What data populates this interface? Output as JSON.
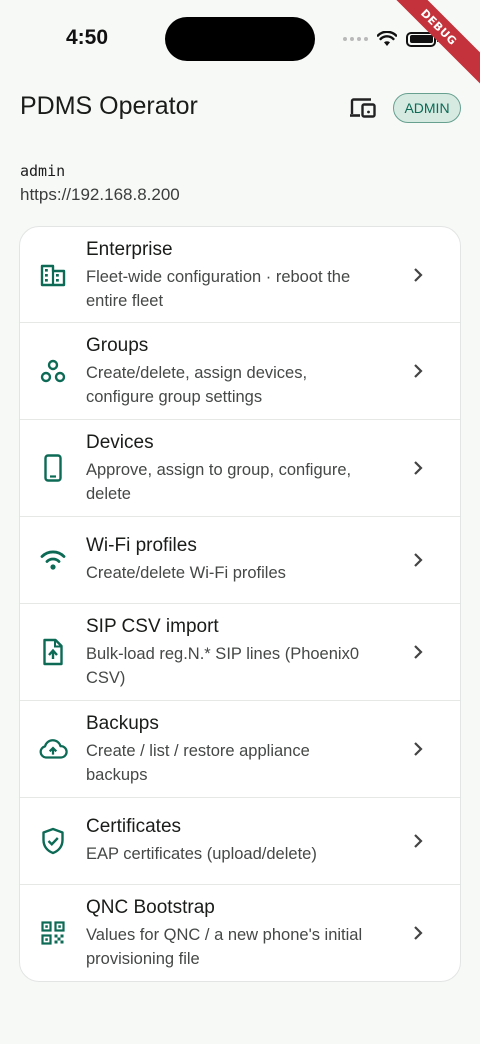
{
  "status_bar": {
    "time": "4:50",
    "icons": [
      "cellular-dots-icon",
      "wifi-icon",
      "battery-icon"
    ]
  },
  "debug_banner": "DEBUG",
  "app_bar": {
    "title": "PDMS Operator",
    "devices_icon": "devices-icon",
    "role_chip": "ADMIN"
  },
  "session": {
    "username": "admin",
    "server": "https://192.168.8.200"
  },
  "colors": {
    "accent": "#0c6a55",
    "chip_bg": "#d6eae2",
    "debug_banner": "#c4323b",
    "background": "#f7f9f7"
  },
  "menu": {
    "items": [
      {
        "icon": "enterprise-building-icon",
        "title": "Enterprise",
        "subtitle_lines": [
          "Fleet-wide configuration · reboot the",
          "entire fleet"
        ]
      },
      {
        "icon": "groups-icon",
        "title": "Groups",
        "subtitle_lines": [
          "Create/delete, assign devices,",
          "configure group settings"
        ]
      },
      {
        "icon": "smartphone-icon",
        "title": "Devices",
        "subtitle_lines": [
          "Approve, assign to group, configure,",
          "delete"
        ]
      },
      {
        "icon": "wifi-icon",
        "title": "Wi-Fi profiles",
        "subtitle_lines": [
          "Create/delete Wi-Fi profiles"
        ]
      },
      {
        "icon": "file-upload-icon",
        "title": "SIP CSV import",
        "subtitle_lines": [
          "Bulk-load reg.N.* SIP lines (Phoenix0",
          "CSV)"
        ]
      },
      {
        "icon": "cloud-upload-icon",
        "title": "Backups",
        "subtitle_lines": [
          "Create / list / restore appliance",
          "backups"
        ]
      },
      {
        "icon": "shield-check-icon",
        "title": "Certificates",
        "subtitle_lines": [
          "EAP certificates (upload/delete)"
        ]
      },
      {
        "icon": "qr-code-icon",
        "title": "QNC Bootstrap",
        "subtitle_lines": [
          "Values for QNC / a new phone's initial",
          "provisioning file"
        ]
      }
    ]
  }
}
